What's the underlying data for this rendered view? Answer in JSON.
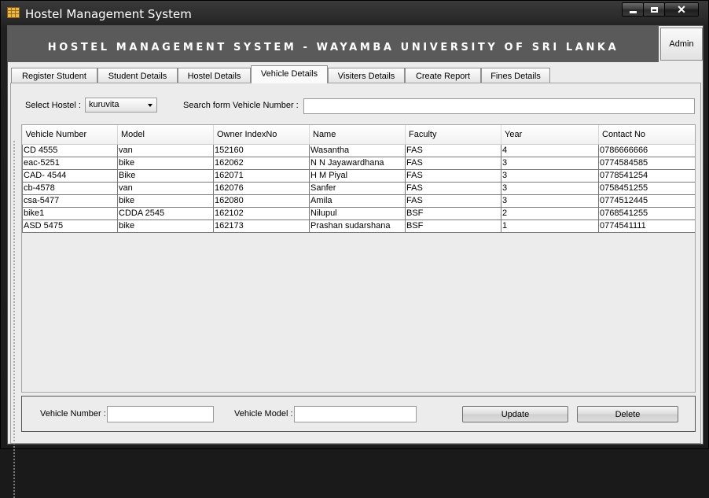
{
  "window": {
    "title": "Hostel Management System",
    "icon": "app-grid-icon",
    "controls": {
      "minimize": "minimize-icon",
      "maximize": "maximize-icon",
      "close": "close-icon",
      "close_label": "✕"
    }
  },
  "header": {
    "title": "HOSTEL MANAGEMENT SYSTEM - WAYAMBA UNIVERSITY OF SRI LANKA",
    "admin_label": "Admin"
  },
  "tabs": [
    {
      "label": "Register Student"
    },
    {
      "label": "Student Details"
    },
    {
      "label": "Hostel Details"
    },
    {
      "label": "Vehicle Details",
      "active": true
    },
    {
      "label": "Visiters Details"
    },
    {
      "label": "Create Report"
    },
    {
      "label": "Fines Details"
    }
  ],
  "filters": {
    "hostel_label": "Select Hostel :",
    "hostel_value": "kuruvita",
    "search_label": "Search form Vehicle Number :",
    "search_value": ""
  },
  "table": {
    "columns": [
      "Vehicle Number",
      "Model",
      "Owner IndexNo",
      "Name",
      "Faculty",
      "Year",
      "Contact No"
    ],
    "rows": [
      [
        "CD 4555",
        "van",
        "152160",
        "Wasantha",
        "FAS",
        "4",
        "0786666666"
      ],
      [
        "eac-5251",
        " bike",
        "162062",
        "N N Jayawardhana",
        "FAS",
        "3",
        "0774584585"
      ],
      [
        "CAD- 4544",
        " Bike",
        "162071",
        "H M Piyal",
        "FAS",
        "3",
        "0778541254"
      ],
      [
        "cb-4578",
        "van",
        "162076",
        "Sanfer",
        "FAS",
        "3",
        "0758451255"
      ],
      [
        "csa-5477",
        "bike",
        "162080",
        "Amila",
        "FAS",
        "3",
        "0774512445"
      ],
      [
        "bike1",
        " CDDA 2545",
        "162102",
        "Nilupul",
        "BSF",
        "2",
        "0768541255"
      ],
      [
        "ASD 5475",
        "bike",
        "162173",
        "Prashan sudarshana",
        "BSF",
        "1",
        "0774541111"
      ]
    ]
  },
  "form": {
    "vehicle_number_label": "Vehicle Number :",
    "vehicle_number_value": "",
    "vehicle_model_label": "Vehicle Model :",
    "vehicle_model_value": "",
    "update_label": "Update",
    "delete_label": "Delete"
  },
  "colors": {
    "title_bar": "#1c1c1c",
    "header_band": "#5a5a5a",
    "panel": "#ececec"
  }
}
